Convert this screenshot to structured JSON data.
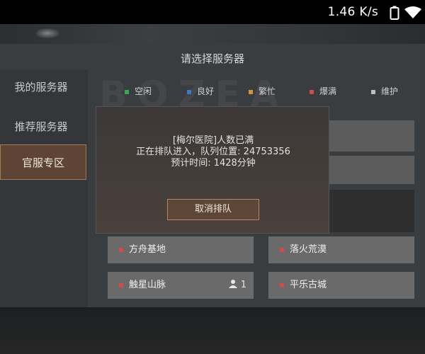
{
  "status_bar": {
    "speed": "1.46 K/s",
    "icons": [
      "battery-icon",
      "wifi-icon"
    ]
  },
  "title": "请选择服务器",
  "watermark": "BOZEA",
  "sidebar": {
    "items": [
      {
        "label": "我的服务器"
      },
      {
        "label": "推荐服务器"
      },
      {
        "label": "官服专区"
      }
    ],
    "active_index": 2
  },
  "legend": [
    {
      "label": "空闲",
      "color": "#39a84b"
    },
    {
      "label": "良好",
      "color": "#3e79c7"
    },
    {
      "label": "繁忙",
      "color": "#d39533"
    },
    {
      "label": "爆满",
      "color": "#d14b4b"
    },
    {
      "label": "维护",
      "color": "#bdbdbd"
    }
  ],
  "servers": [
    {
      "name": "方舟基地",
      "users": ""
    },
    {
      "name": "落火荒漠",
      "users": ""
    },
    {
      "name": "触星山脉",
      "users": "1"
    },
    {
      "name": "平乐古城",
      "users": ""
    }
  ],
  "dialog": {
    "line1": "[梅尔医院]人数已满",
    "line2": "正在排队进入，队列位置: 24753356",
    "line3": "预计时间: 1428分钟",
    "cancel_label": "取消排队"
  }
}
